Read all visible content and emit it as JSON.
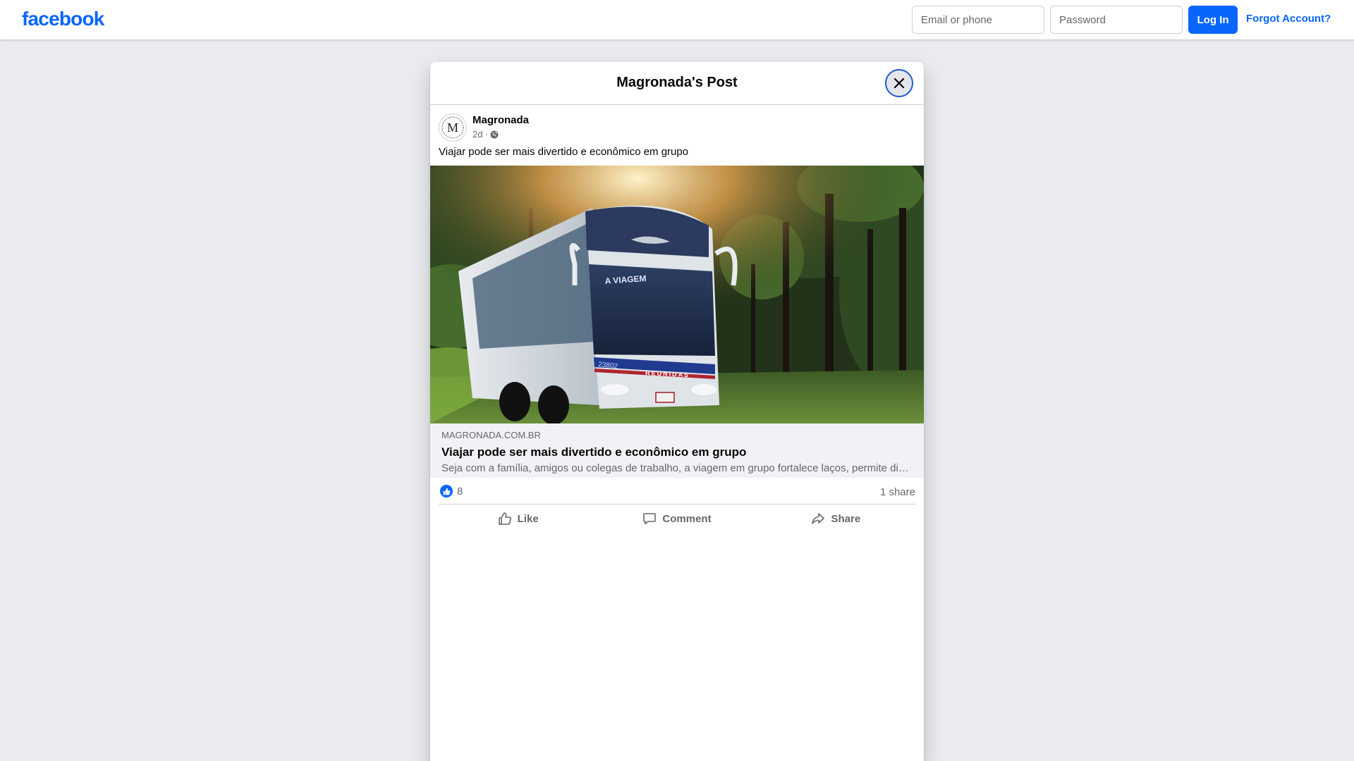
{
  "header": {
    "logo_text": "facebook",
    "email_placeholder": "Email or phone",
    "password_placeholder": "Password",
    "login_label": "Log In",
    "forgot_label": "Forgot Account?"
  },
  "modal": {
    "title": "Magronada's Post",
    "close_icon": "close-icon"
  },
  "post": {
    "author": "Magronada",
    "avatar_letter": "M",
    "time": "2d",
    "separator": "·",
    "audience_icon": "globe-icon",
    "text": "Viajar pode ser mais divertido e econômico em grupo"
  },
  "link_preview": {
    "domain": "MAGRONADA.COM.BR",
    "title": "Viajar pode ser mais divertido e econômico em grupo",
    "description": "Seja com a família, amigos ou colegas de trabalho, a viagem em grupo fortalece laços, permite divi...",
    "image_texts": {
      "bus_sign": "A VIAGEM",
      "bus_number": "23802",
      "bus_brand": "REUNIDAS"
    }
  },
  "engagement": {
    "like_count": "8",
    "share_count": "1 share"
  },
  "actions": {
    "like": "Like",
    "comment": "Comment",
    "share": "Share"
  },
  "colors": {
    "brand_blue": "#0866ff",
    "background": "#e9ebee",
    "secondary_text": "#65676b"
  }
}
